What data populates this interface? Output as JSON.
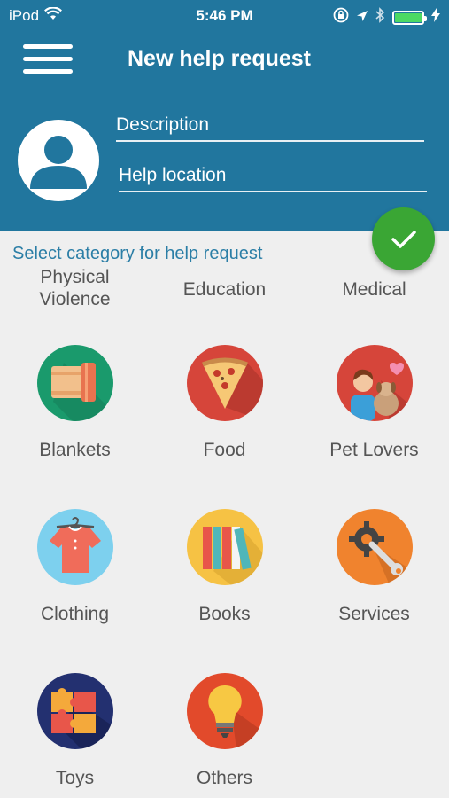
{
  "status_bar": {
    "carrier": "iPod",
    "time": "5:46 PM"
  },
  "nav": {
    "title": "New help request",
    "menu_icon": "hamburger-menu-icon"
  },
  "form": {
    "description_placeholder": "Description",
    "location_placeholder": "Help location"
  },
  "submit_icon": "checkmark-icon",
  "section_title": "Select category for help request",
  "partial_row": [
    "Physical Violence",
    "Education",
    "Medical"
  ],
  "categories": [
    {
      "label": "Blankets",
      "icon": "blankets-icon",
      "color": "#1a9a6c"
    },
    {
      "label": "Food",
      "icon": "pizza-icon",
      "color": "#d6453a"
    },
    {
      "label": "Pet Lovers",
      "icon": "pet-lovers-icon",
      "color": "#d6453a"
    },
    {
      "label": "Clothing",
      "icon": "shirt-icon",
      "color": "#7dd0ee"
    },
    {
      "label": "Books",
      "icon": "books-icon",
      "color": "#f6c244"
    },
    {
      "label": "Services",
      "icon": "wrench-gear-icon",
      "color": "#f0832e"
    },
    {
      "label": "Toys",
      "icon": "puzzle-icon",
      "color": "#233070"
    },
    {
      "label": "Others",
      "icon": "lightbulb-icon",
      "color": "#e24a2b"
    }
  ],
  "colors": {
    "header": "#21769e",
    "accent_text": "#2b7ea6",
    "fab": "#3aa634"
  }
}
